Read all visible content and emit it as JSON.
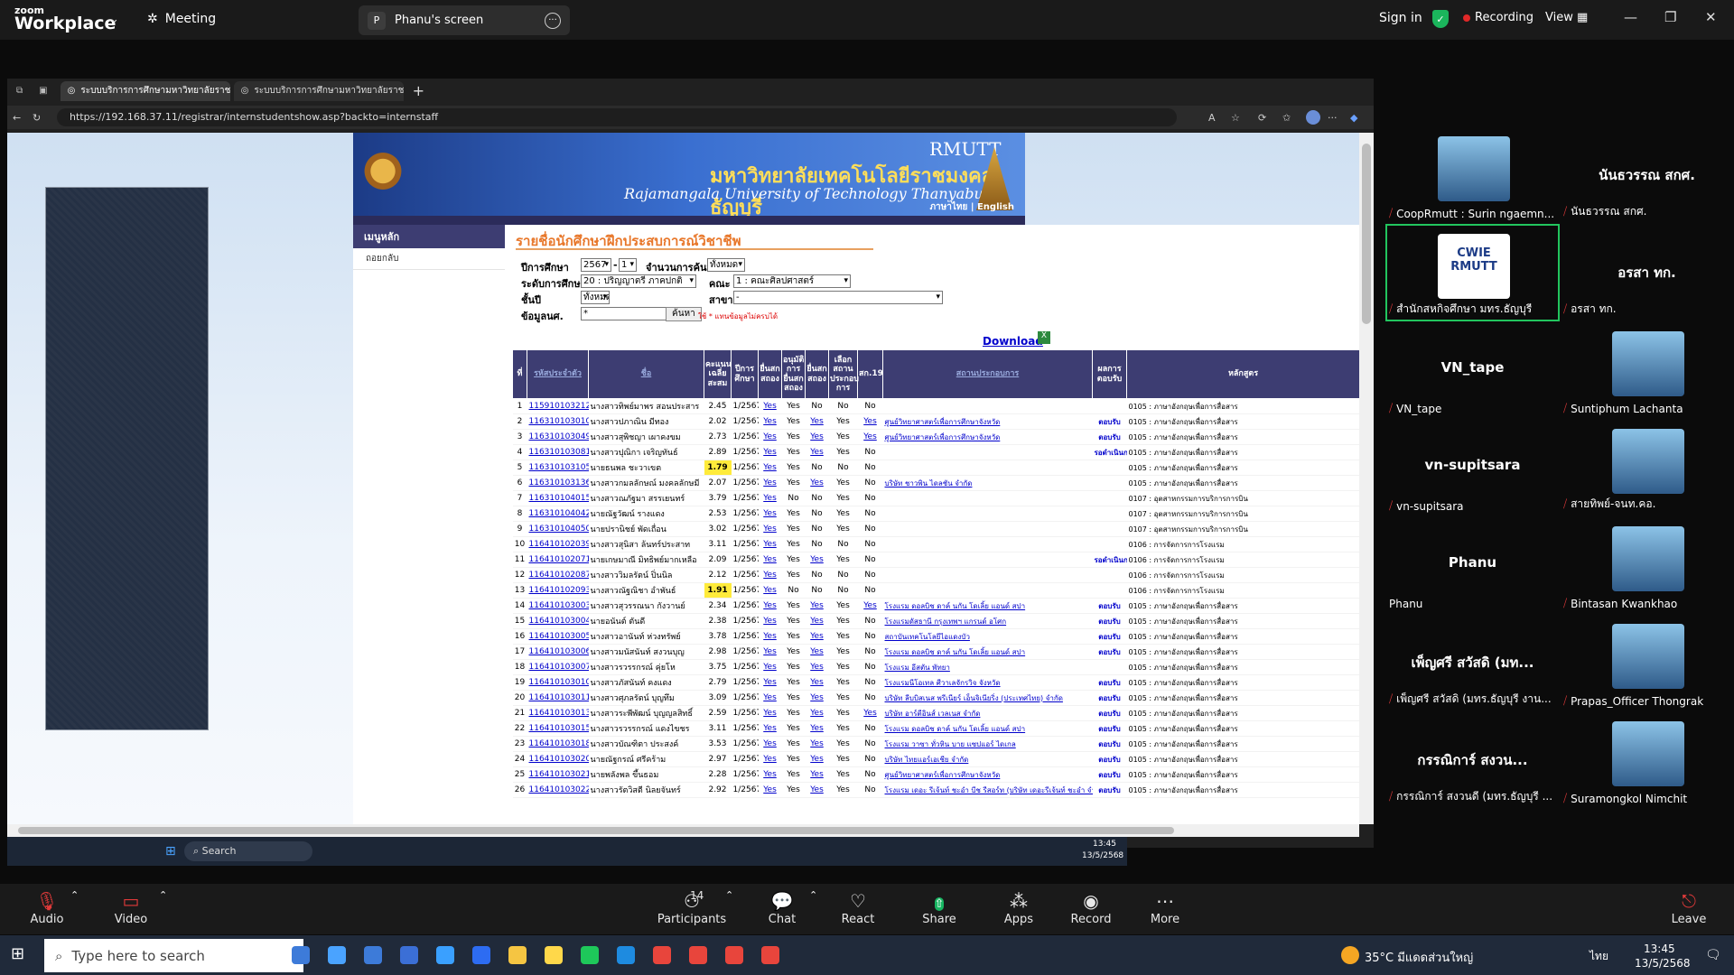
{
  "zoom": {
    "brand_small": "zoom",
    "brand_big": "Workplace",
    "meeting_label": "Meeting",
    "sharer_initial": "P",
    "sharer_label": "Phanu's screen",
    "sign_in": "Sign in",
    "recording": "Recording",
    "view": "View"
  },
  "browser": {
    "tab1": "ระบบบริการการศึกษามหาวิทยาลัยราช",
    "tab2": "ระบบบริการการศึกษามหาวิทยาลัยราช",
    "url": "https://192.168.37.11/registrar/internstudentshow.asp?backto=internstaff"
  },
  "banner": {
    "rmutt": "RMUTT",
    "thai": "มหาวิทยาลัยเทคโนโลยีราชมงคลธัญบุรี",
    "english": "Rajamangala University of Technology Thanyaburi",
    "lang": "ภาษาไทย | English"
  },
  "menu": {
    "header": "เมนูหลัก",
    "item": "ถอยกลับ"
  },
  "content": {
    "title": "รายชื่อนักศึกษาฝึกประสบการณ์วิชาชีพ",
    "f_year_label": "ปีการศึกษา",
    "f_year": "2567",
    "f_term": "1",
    "f_count_label": "จำนวนการค้นหา",
    "f_count": "ทั้งหมด",
    "f_level_label": "ระดับการศึกษา",
    "f_level": "20 : ปริญญาตรี ภาคปกติ",
    "f_faculty_label": "คณะ",
    "f_faculty": "1 : คณะศิลปศาสตร์",
    "f_class_label": "ชั้นปี",
    "f_class": "ทั้งหมด",
    "f_major_label": "สาขา",
    "f_major": "-",
    "f_info_label": "ข้อมูลนศ.",
    "f_info": "*",
    "search_btn": "ค้นหา",
    "note": "ใช้ * แทนข้อมูลไม่ครบได้",
    "download": "Download"
  },
  "table": {
    "headers": [
      "ที่",
      "รหัสประจำตัว",
      "ชื่อ",
      "คะแนนเฉลี่ยสะสม",
      "ปีการศึกษา",
      "ยื่นสกสถอง",
      "อนุมัติการยื่นสกสถอง",
      "ยื่นสกสถอง",
      "เลือกสถานประกอบการ",
      "สก.19",
      "สถานประกอบการ",
      "ผลการตอบรับ",
      "หลักสูตร"
    ],
    "rows": [
      [
        "1",
        "115910103212-9",
        "นางสาวทิพย์มาพร สอนประสาร",
        "2.45",
        "1/2567",
        "Yes",
        "Yes",
        "No",
        "No",
        "No",
        "",
        "",
        "0105 : ภาษาอังกฤษเพื่อการสื่อสาร"
      ],
      [
        "2",
        "116310103010-9",
        "นางสาวปภาณิน มีทอง",
        "2.02",
        "1/2567",
        "Yes",
        "Yes",
        "Yes",
        "Yes",
        "Yes",
        "ศูนย์วิทยาศาสตร์เพื่อการศึกษาจังหวัด",
        "ตอบรับ",
        "0105 : ภาษาอังกฤษเพื่อการสื่อสาร"
      ],
      [
        "3",
        "116310103049-7",
        "นางสาวสุพิชญา เผาคงขม",
        "2.73",
        "1/2567",
        "Yes",
        "Yes",
        "Yes",
        "Yes",
        "Yes",
        "ศูนย์วิทยาศาสตร์เพื่อการศึกษาจังหวัด",
        "ตอบรับ",
        "0105 : ภาษาอังกฤษเพื่อการสื่อสาร"
      ],
      [
        "4",
        "116310103081-0",
        "นางสาวปุณิกา เจริญทันธ์",
        "2.89",
        "1/2567",
        "Yes",
        "Yes",
        "Yes",
        "Yes",
        "No",
        "",
        "รอดำเนินการ",
        "0105 : ภาษาอังกฤษเพื่อการสื่อสาร"
      ],
      [
        "5",
        "116310103105-7",
        "นายธนพล ชะวาเขต",
        "1.79",
        "1/2567",
        "Yes",
        "Yes",
        "No",
        "No",
        "No",
        "",
        "",
        "0105 : ภาษาอังกฤษเพื่อการสื่อสาร"
      ],
      [
        "6",
        "116310103136-2",
        "นางสาวกมลลักษณ์ มงคลลักษมี",
        "2.07",
        "1/2567",
        "Yes",
        "Yes",
        "Yes",
        "Yes",
        "No",
        "บริษัท ชาวพิน ไดลชัน จำกัด",
        "",
        "0105 : ภาษาอังกฤษเพื่อการสื่อสาร"
      ],
      [
        "7",
        "116310104015-7",
        "นางสาวณภัฐมา สรรเยนทร์",
        "3.79",
        "1/2567",
        "Yes",
        "No",
        "No",
        "Yes",
        "No",
        "",
        "",
        "0107 : อุตสาหกรรมการบริการการบิน"
      ],
      [
        "8",
        "116310104042-1",
        "นายณัฐวัฒน์ รางแดง",
        "2.53",
        "1/2567",
        "Yes",
        "Yes",
        "No",
        "Yes",
        "No",
        "",
        "",
        "0107 : อุตสาหกรรมการบริการการบิน"
      ],
      [
        "9",
        "116310104050-4",
        "นายปรานิชย์ พัดเถื่อน",
        "3.02",
        "1/2567",
        "Yes",
        "Yes",
        "No",
        "Yes",
        "No",
        "",
        "",
        "0107 : อุตสาหกรรมการบริการการบิน"
      ],
      [
        "10",
        "116410102039-7",
        "นางสาวสุนิสา ล้นทร์ประสาท",
        "3.11",
        "1/2567",
        "Yes",
        "Yes",
        "No",
        "No",
        "No",
        "",
        "",
        "0106 : การจัดการการโรงแรม"
      ],
      [
        "11",
        "116410102071-0",
        "นายเกษมาณี มิทธิพย์มากเหลือ",
        "2.09",
        "1/2567",
        "Yes",
        "Yes",
        "Yes",
        "Yes",
        "No",
        "",
        "รอดำเนินการ",
        "0106 : การจัดการการโรงแรม"
      ],
      [
        "12",
        "116410102087-6",
        "นางสาววิมลรัตน์ ปิ่นนิล",
        "2.12",
        "1/2567",
        "Yes",
        "Yes",
        "No",
        "No",
        "No",
        "",
        "",
        "0106 : การจัดการการโรงแรม"
      ],
      [
        "13",
        "116410102093-4",
        "นางสาวณัฐณิชา อำพันธ์",
        "1.91",
        "1/2567",
        "Yes",
        "No",
        "No",
        "No",
        "No",
        "",
        "",
        "0106 : การจัดการการโรงแรม"
      ],
      [
        "14",
        "116410103003-2",
        "นางสาวสุวรรณนา กังวานย์",
        "2.34",
        "1/2567",
        "Yes",
        "Yes",
        "Yes",
        "Yes",
        "Yes",
        "โรงแรม ดอลบิช ดาค์ นกัน โดเลิ้ย แอนด์ สปา",
        "ตอบรับ",
        "0105 : ภาษาอังกฤษเพื่อการสื่อสาร"
      ],
      [
        "15",
        "116410103004-0",
        "นายอนันต์ ตันดี",
        "2.38",
        "1/2567",
        "Yes",
        "Yes",
        "Yes",
        "Yes",
        "No",
        "โรงแรมดัสธานี กรุงเทพฯ แกรนด์ อโศก",
        "ตอบรับ",
        "0105 : ภาษาอังกฤษเพื่อการสื่อสาร"
      ],
      [
        "16",
        "116410103005-7",
        "นางสาวอานันท์ ห่วงทรัพย์",
        "3.78",
        "1/2567",
        "Yes",
        "Yes",
        "Yes",
        "Yes",
        "No",
        "สถาบันเทคโนโลยีไอแดงบัว",
        "ตอบรับ",
        "0105 : ภาษาอังกฤษเพื่อการสื่อสาร"
      ],
      [
        "17",
        "116410103006-5",
        "นางสาวมนัสนันท์ สงวนบุญ",
        "2.98",
        "1/2567",
        "Yes",
        "Yes",
        "Yes",
        "Yes",
        "No",
        "โรงแรม ดอลบิช ดาค์ นกัน โดเลิ้ย แอนด์ สปา",
        "ตอบรับ",
        "0105 : ภาษาอังกฤษเพื่อการสื่อสาร"
      ],
      [
        "18",
        "116410103007-3",
        "นางสาวรวรรกรณ์ คุ่ยโห",
        "3.75",
        "1/2567",
        "Yes",
        "Yes",
        "Yes",
        "Yes",
        "No",
        "โรงแรม อีสตัน พัทยา",
        "",
        "0105 : ภาษาอังกฤษเพื่อการสื่อสาร"
      ],
      [
        "19",
        "116410103010-7",
        "นางสาวภัสนันท์ คงแดง",
        "2.79",
        "1/2567",
        "Yes",
        "Yes",
        "Yes",
        "Yes",
        "No",
        "โรงแรมนีโอเทล ศีวาเลจักรวิจ จังหวัด",
        "ตอบรับ",
        "0105 : ภาษาอังกฤษเพื่อการสื่อสาร"
      ],
      [
        "20",
        "116410103011-5",
        "นางสาวศุภลรัตน์ บุญทึม",
        "3.09",
        "1/2567",
        "Yes",
        "Yes",
        "Yes",
        "Yes",
        "No",
        "บริษัท ลีบบิสเนส พรีเนียร์ เอ็นจิเนียริ่ง (ประเทศไทย) จำกัด",
        "ตอบรับ",
        "0105 : ภาษาอังกฤษเพื่อการสื่อสาร"
      ],
      [
        "21",
        "116410103013-1",
        "นางสาวระพีพัฒน์ บุญญลสิทธิ์",
        "2.59",
        "1/2567",
        "Yes",
        "Yes",
        "Yes",
        "Yes",
        "Yes",
        "บริษัท อาร์ตีอินส์ เวลเนส จำกัด",
        "ตอบรับ",
        "0105 : ภาษาอังกฤษเพื่อการสื่อสาร"
      ],
      [
        "22",
        "116410103015-6",
        "นางสาวรวรรกรณ์ แดงไขชร",
        "3.11",
        "1/2567",
        "Yes",
        "Yes",
        "Yes",
        "Yes",
        "No",
        "โรงแรม ดอลบิช ดาค์ นกัน โดเลิ้ย แอนด์ สปา",
        "ตอบรับ",
        "0105 : ภาษาอังกฤษเพื่อการสื่อสาร"
      ],
      [
        "23",
        "116410103018-0",
        "นางสาวบัณฑิตา ประสงค์",
        "3.53",
        "1/2567",
        "Yes",
        "Yes",
        "Yes",
        "Yes",
        "No",
        "โรงแรม วาซา ทั่วหิน บาย แซปแอร์ ไดเกล",
        "ตอบรับ",
        "0105 : ภาษาอังกฤษเพื่อการสื่อสาร"
      ],
      [
        "24",
        "116410103020-6",
        "นายณัฐกรณ์ ศรีคร้าม",
        "2.97",
        "1/2567",
        "Yes",
        "Yes",
        "Yes",
        "Yes",
        "No",
        "บริษัท ไทยแอร์เอเชีย จำกัด",
        "ตอบรับ",
        "0105 : ภาษาอังกฤษเพื่อการสื่อสาร"
      ],
      [
        "25",
        "116410103021-4",
        "นายพลังพล ขึ้นธอม",
        "2.28",
        "1/2567",
        "Yes",
        "Yes",
        "Yes",
        "Yes",
        "No",
        "ศูนย์วิทยาศาสตร์เพื่อการศึกษาจังหวัด",
        "ตอบรับ",
        "0105 : ภาษาอังกฤษเพื่อการสื่อสาร"
      ],
      [
        "26",
        "116410103022-2",
        "นางสาวรัตวิสตี นิลยจันทร์",
        "2.92",
        "1/2567",
        "Yes",
        "Yes",
        "Yes",
        "Yes",
        "No",
        "โรงแรม เดอะ รีเจ้นท์ ชะอำ บีช รีสอร์ท (บริษัท เดอะรีเจ้นท์ ชะอำ จำกัด)",
        "ตอบรับ",
        "0105 : ภาษาอังกฤษเพื่อการสื่อสาร"
      ]
    ]
  },
  "taskbar_inner": {
    "search": "Search",
    "time": "13:45",
    "date": "13/5/2568"
  },
  "gallery": [
    {
      "name": "",
      "label": "CoopRmutt : Surin ngaemn..."
    },
    {
      "name": "นันธวรรณ สกศ.",
      "label": "นันธวรรณ สกศ."
    },
    {
      "name": "CWIE RMUTT",
      "label": "สำนักสหกิจศึกษา มทร.ธัญบุรี"
    },
    {
      "name": "อรสา ทก.",
      "label": "อรสา ทก."
    },
    {
      "name": "VN_tape",
      "label": "VN_tape"
    },
    {
      "name": "",
      "label": "Suntiphum Lachanta"
    },
    {
      "name": "vn-supitsara",
      "label": "vn-supitsara"
    },
    {
      "name": "",
      "label": "สายทิพย์-จนท.คอ."
    },
    {
      "name": "Phanu",
      "label": "Phanu"
    },
    {
      "name": "",
      "label": "Bintasan Kwankhao"
    },
    {
      "name": "เพ็ญศรี สวัสดิ (มท...",
      "label": "เพ็ญศรี สวัสดิ (มทร.ธัญบุรี งาน..."
    },
    {
      "name": "",
      "label": "Prapas_Officer Thongrak"
    },
    {
      "name": "กรรณิการ์ สงวน...",
      "label": "กรรณิการ์ สงวนดี (มทร.ธัญบุรี ..."
    },
    {
      "name": "",
      "label": "Suramongkol Nimchit"
    }
  ],
  "bottom": {
    "audio": "Audio",
    "video": "Video",
    "participants": "Participants",
    "participants_count": "14",
    "chat": "Chat",
    "react": "React",
    "share": "Share",
    "apps": "Apps",
    "record": "Record",
    "more": "More",
    "leave": "Leave"
  },
  "win": {
    "search": "Type here to search",
    "weather": "35°C มีแดดส่วนใหญ่",
    "lang": "ไทย",
    "time": "13:45",
    "date": "13/5/2568"
  }
}
